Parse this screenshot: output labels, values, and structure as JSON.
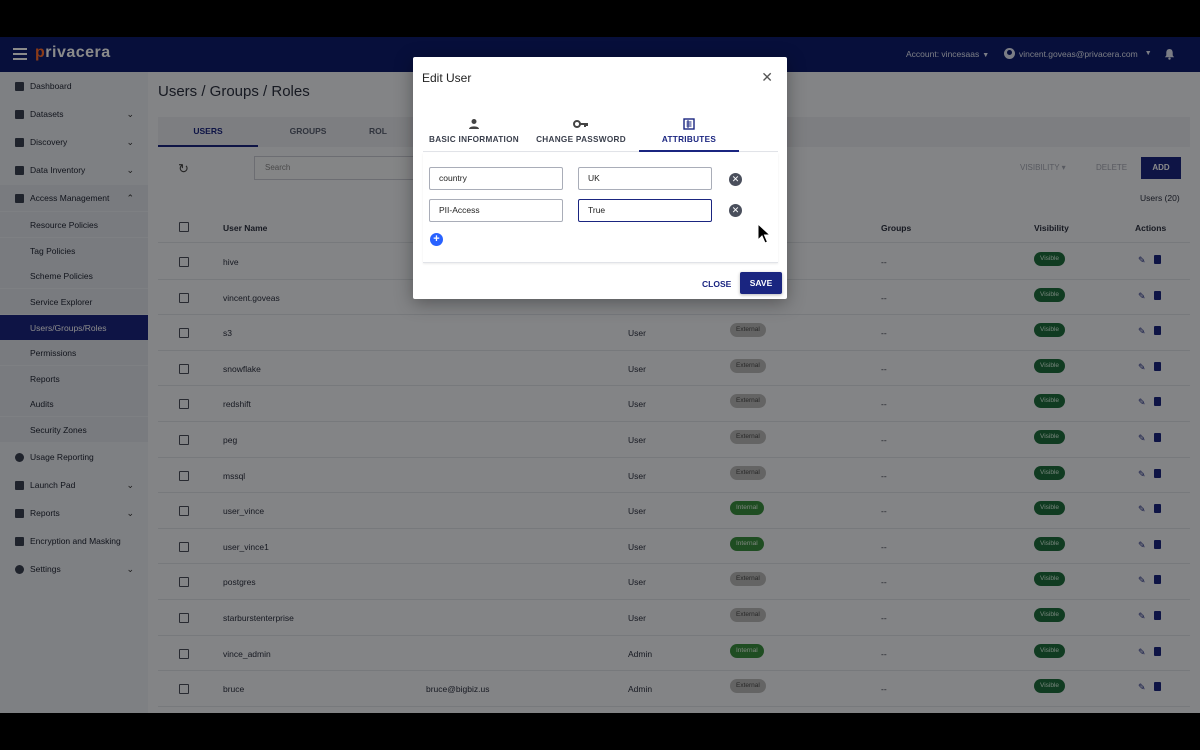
{
  "brand": {
    "name": "rivacera",
    "prefix": "p"
  },
  "topbar": {
    "account": "Account: vincesaas",
    "user_email": "vincent.goveas@privacera.com"
  },
  "sidebar": {
    "items": [
      {
        "label": "Dashboard"
      },
      {
        "label": "Datasets"
      },
      {
        "label": "Discovery"
      },
      {
        "label": "Data Inventory"
      },
      {
        "label": "Access Management"
      },
      {
        "label": "Resource Policies"
      },
      {
        "label": "Tag Policies"
      },
      {
        "label": "Scheme Policies"
      },
      {
        "label": "Service Explorer"
      },
      {
        "label": "Users/Groups/Roles"
      },
      {
        "label": "Permissions"
      },
      {
        "label": "Reports"
      },
      {
        "label": "Audits"
      },
      {
        "label": "Security Zones"
      },
      {
        "label": "Usage Reporting"
      },
      {
        "label": "Launch Pad"
      },
      {
        "label": "Reports"
      },
      {
        "label": "Encryption and Masking"
      },
      {
        "label": "Settings"
      }
    ]
  },
  "main": {
    "title": "Users / Groups / Roles",
    "tabs": [
      {
        "label": "USERS"
      },
      {
        "label": "GROUPS"
      },
      {
        "label": "ROL"
      }
    ],
    "search_placeholder": "Search",
    "visibility_label": "VISIBILITY",
    "delete_label": "DELETE",
    "add_label": "ADD",
    "count": "Users (20)",
    "columns": {
      "user_name": "User Name",
      "groups": "Groups",
      "visibility": "Visibility",
      "actions": "Actions"
    },
    "rows": [
      {
        "name": "hive",
        "email": "",
        "type": "",
        "source": "",
        "groups": "--",
        "visibility": "Visible"
      },
      {
        "name": "vincent.goveas",
        "email": "",
        "type": "",
        "source": "",
        "groups": "--",
        "visibility": "Visible"
      },
      {
        "name": "s3",
        "email": "",
        "type": "User",
        "source": "External",
        "groups": "--",
        "visibility": "Visible"
      },
      {
        "name": "snowflake",
        "email": "",
        "type": "User",
        "source": "External",
        "groups": "--",
        "visibility": "Visible"
      },
      {
        "name": "redshift",
        "email": "",
        "type": "User",
        "source": "External",
        "groups": "--",
        "visibility": "Visible"
      },
      {
        "name": "peg",
        "email": "",
        "type": "User",
        "source": "External",
        "groups": "--",
        "visibility": "Visible"
      },
      {
        "name": "mssql",
        "email": "",
        "type": "User",
        "source": "External",
        "groups": "--",
        "visibility": "Visible"
      },
      {
        "name": "user_vince",
        "email": "",
        "type": "User",
        "source": "Internal",
        "groups": "--",
        "visibility": "Visible"
      },
      {
        "name": "user_vince1",
        "email": "",
        "type": "User",
        "source": "Internal",
        "groups": "--",
        "visibility": "Visible"
      },
      {
        "name": "postgres",
        "email": "",
        "type": "User",
        "source": "External",
        "groups": "--",
        "visibility": "Visible"
      },
      {
        "name": "starburstenterprise",
        "email": "",
        "type": "User",
        "source": "External",
        "groups": "--",
        "visibility": "Visible"
      },
      {
        "name": "vince_admin",
        "email": "",
        "type": "Admin",
        "source": "Internal",
        "groups": "--",
        "visibility": "Visible"
      },
      {
        "name": "bruce",
        "email": "bruce@bigbiz.us",
        "type": "Admin",
        "source": "External",
        "groups": "--",
        "visibility": "Visible"
      }
    ]
  },
  "modal": {
    "title": "Edit User",
    "tabs": [
      {
        "label": "BASIC INFORMATION",
        "icon": "person-icon"
      },
      {
        "label": "CHANGE PASSWORD",
        "icon": "key-icon"
      },
      {
        "label": "ATTRIBUTES",
        "icon": "attributes-icon"
      }
    ],
    "attributes": [
      {
        "key": "country",
        "value": "UK"
      },
      {
        "key": "PII-Access",
        "value": "True"
      }
    ],
    "close_label": "CLOSE",
    "save_label": "SAVE"
  },
  "colors": {
    "primary": "#1a2580",
    "topbar": "#0d1d6e",
    "brand_accent": "#ff6d2e",
    "visible_badge": "#1f6e3e",
    "internal_badge": "#3a8f3f",
    "external_badge": "#b9b9b9"
  }
}
